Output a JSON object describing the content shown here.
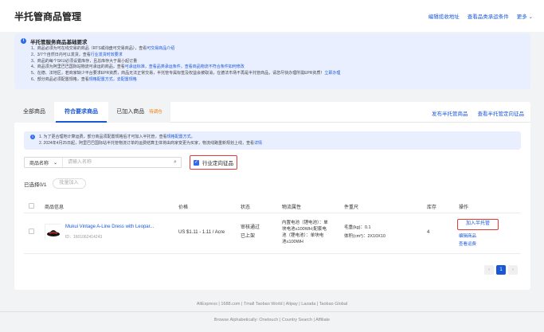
{
  "header": {
    "title": "半托管商品管理",
    "links": [
      "编辑揽收地址",
      "查看品类承运条件",
      "更多"
    ]
  },
  "notice": {
    "title": "半托管服务商品基础要求",
    "items": [
      {
        "text": "1、商品必须为可在线交易的商品（RTS或询盘可交易商品），查看",
        "link": "可交易商品介绍"
      },
      {
        "text": "2、3/7个自然日内可以发货，查看",
        "link": "行业发货时效要求"
      },
      {
        "text": "3、商品的每个SKU必须设置库存，且总库存大于最小起订量",
        "link": ""
      },
      {
        "text": "4、商品须为阿里巴巴国际站物流可承运的商品，查看",
        "link": "可承运标准，查看品类承运条件，查看商品物流不符合条件如何修改"
      },
      {
        "text": "5、在德、法地区，若商家缺少平台要求EPR资质，商品无法正常交易，半托管专属标签及权益会被取消，在德法市场不再是半托管商品，请您尽快办理所需EPR资质！",
        "link": "立即办理"
      },
      {
        "text": "6、部分商品必须配置规格，查看",
        "link": "规格配置方式，去配置规格"
      }
    ]
  },
  "tabs": [
    {
      "label": "全部商品"
    },
    {
      "label": "符合要求商品"
    },
    {
      "label": "已加入商品",
      "badge": "待调仓"
    }
  ],
  "tab_actions": [
    "发布半托管商品",
    "查看半托管定向征品"
  ],
  "inner_notice": [
    {
      "text": "1. 为了更合理地计算运费，部分商品须配置规格后才可加入半托管，查看",
      "link": "规格配置方式。"
    },
    {
      "text": "2. 2024年4月25日起，阿里巴巴国际站半托管物流订单的运费结算主体将由商家变更为买家，物流线路重新规划上线，查看",
      "link": "详情"
    }
  ],
  "search": {
    "field_label": "商品名称",
    "placeholder": "请输入名称"
  },
  "filter": {
    "label": "行业定向征品",
    "checked": true
  },
  "selection": {
    "selected_text": "已选择0/1",
    "batch_button": "批量加入"
  },
  "table": {
    "headers": [
      "商品信息",
      "价格",
      "状态",
      "物流属性",
      "件重尺",
      "库存",
      "操作"
    ],
    "rows": [
      {
        "title": "Mukui Vintage A-Line Dress with Leopar...",
        "id": "ID：1601062414243",
        "price": "US $1.11 - 1.11 / Acre",
        "status": [
          "审核通过",
          "已上架"
        ],
        "logistics": [
          "内置电池（锂电池）：单",
          "块电池≤100WH;配套电",
          "池（锂电池）：单块电",
          "池≤100WH"
        ],
        "weight": "毛重(kg)：0.1",
        "volume": "体积(cm³)：2X10X10",
        "stock": "4",
        "actions": [
          "加入半托管",
          "编辑商品",
          "查看运费"
        ]
      }
    ]
  },
  "pagination": {
    "prev": "‹",
    "current": "1",
    "next": "›"
  },
  "footer": {
    "line1": "AliExpress | 1688.com | Tmall Taobao World | Alipay | Lazada | Taobao Global",
    "line2": "Browse Alphabetically: Onetouch | Country Search | Affiliate"
  }
}
